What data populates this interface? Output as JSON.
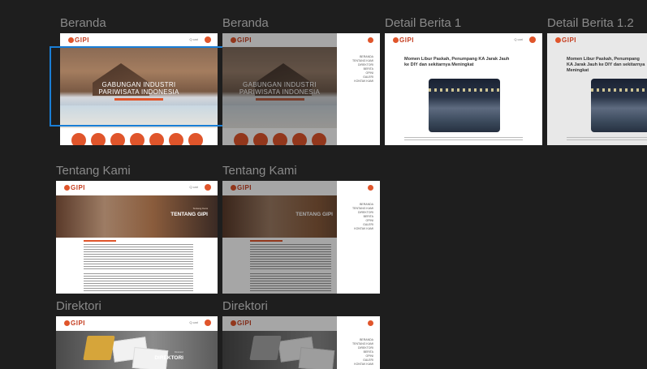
{
  "frames": [
    {
      "label": "Beranda"
    },
    {
      "label": "Beranda"
    },
    {
      "label": "Detail Berita 1"
    },
    {
      "label": "Detail Berita 1.2"
    },
    {
      "label": "Tentang Kami"
    },
    {
      "label": "Tentang Kami"
    },
    {
      "label": "Direktori"
    },
    {
      "label": "Direktori"
    }
  ],
  "site": {
    "logo": "GIPI",
    "hero_line1": "GABUNGAN INDUSTRI",
    "hero_line2": "PARIWISATA INDONESIA",
    "menu": [
      "BERANDA",
      "TENTANG KAMI",
      "DIREKTORI",
      "BERITA",
      "OPINI",
      "GALERI",
      "KONTAK KAMI"
    ]
  },
  "news": {
    "title": "Momen Libur Paskah, Penumpang KA Jarak Jauh ke DIY dan sekitarnya Meningkat",
    "title_short": "Momen Libur Paskah, Penumpang KA Jarak Jauh ke DIY dan sekitarnya Meningkat"
  },
  "about": {
    "title": "TENTANG GIPI",
    "subtitle": "Tentang Kami"
  },
  "directory": {
    "title": "DIREKTORI",
    "subtitle": "Direktori"
  },
  "colors": {
    "accent": "#e0552b",
    "canvas": "#1e1e1e",
    "selection": "#1a7ed6"
  }
}
